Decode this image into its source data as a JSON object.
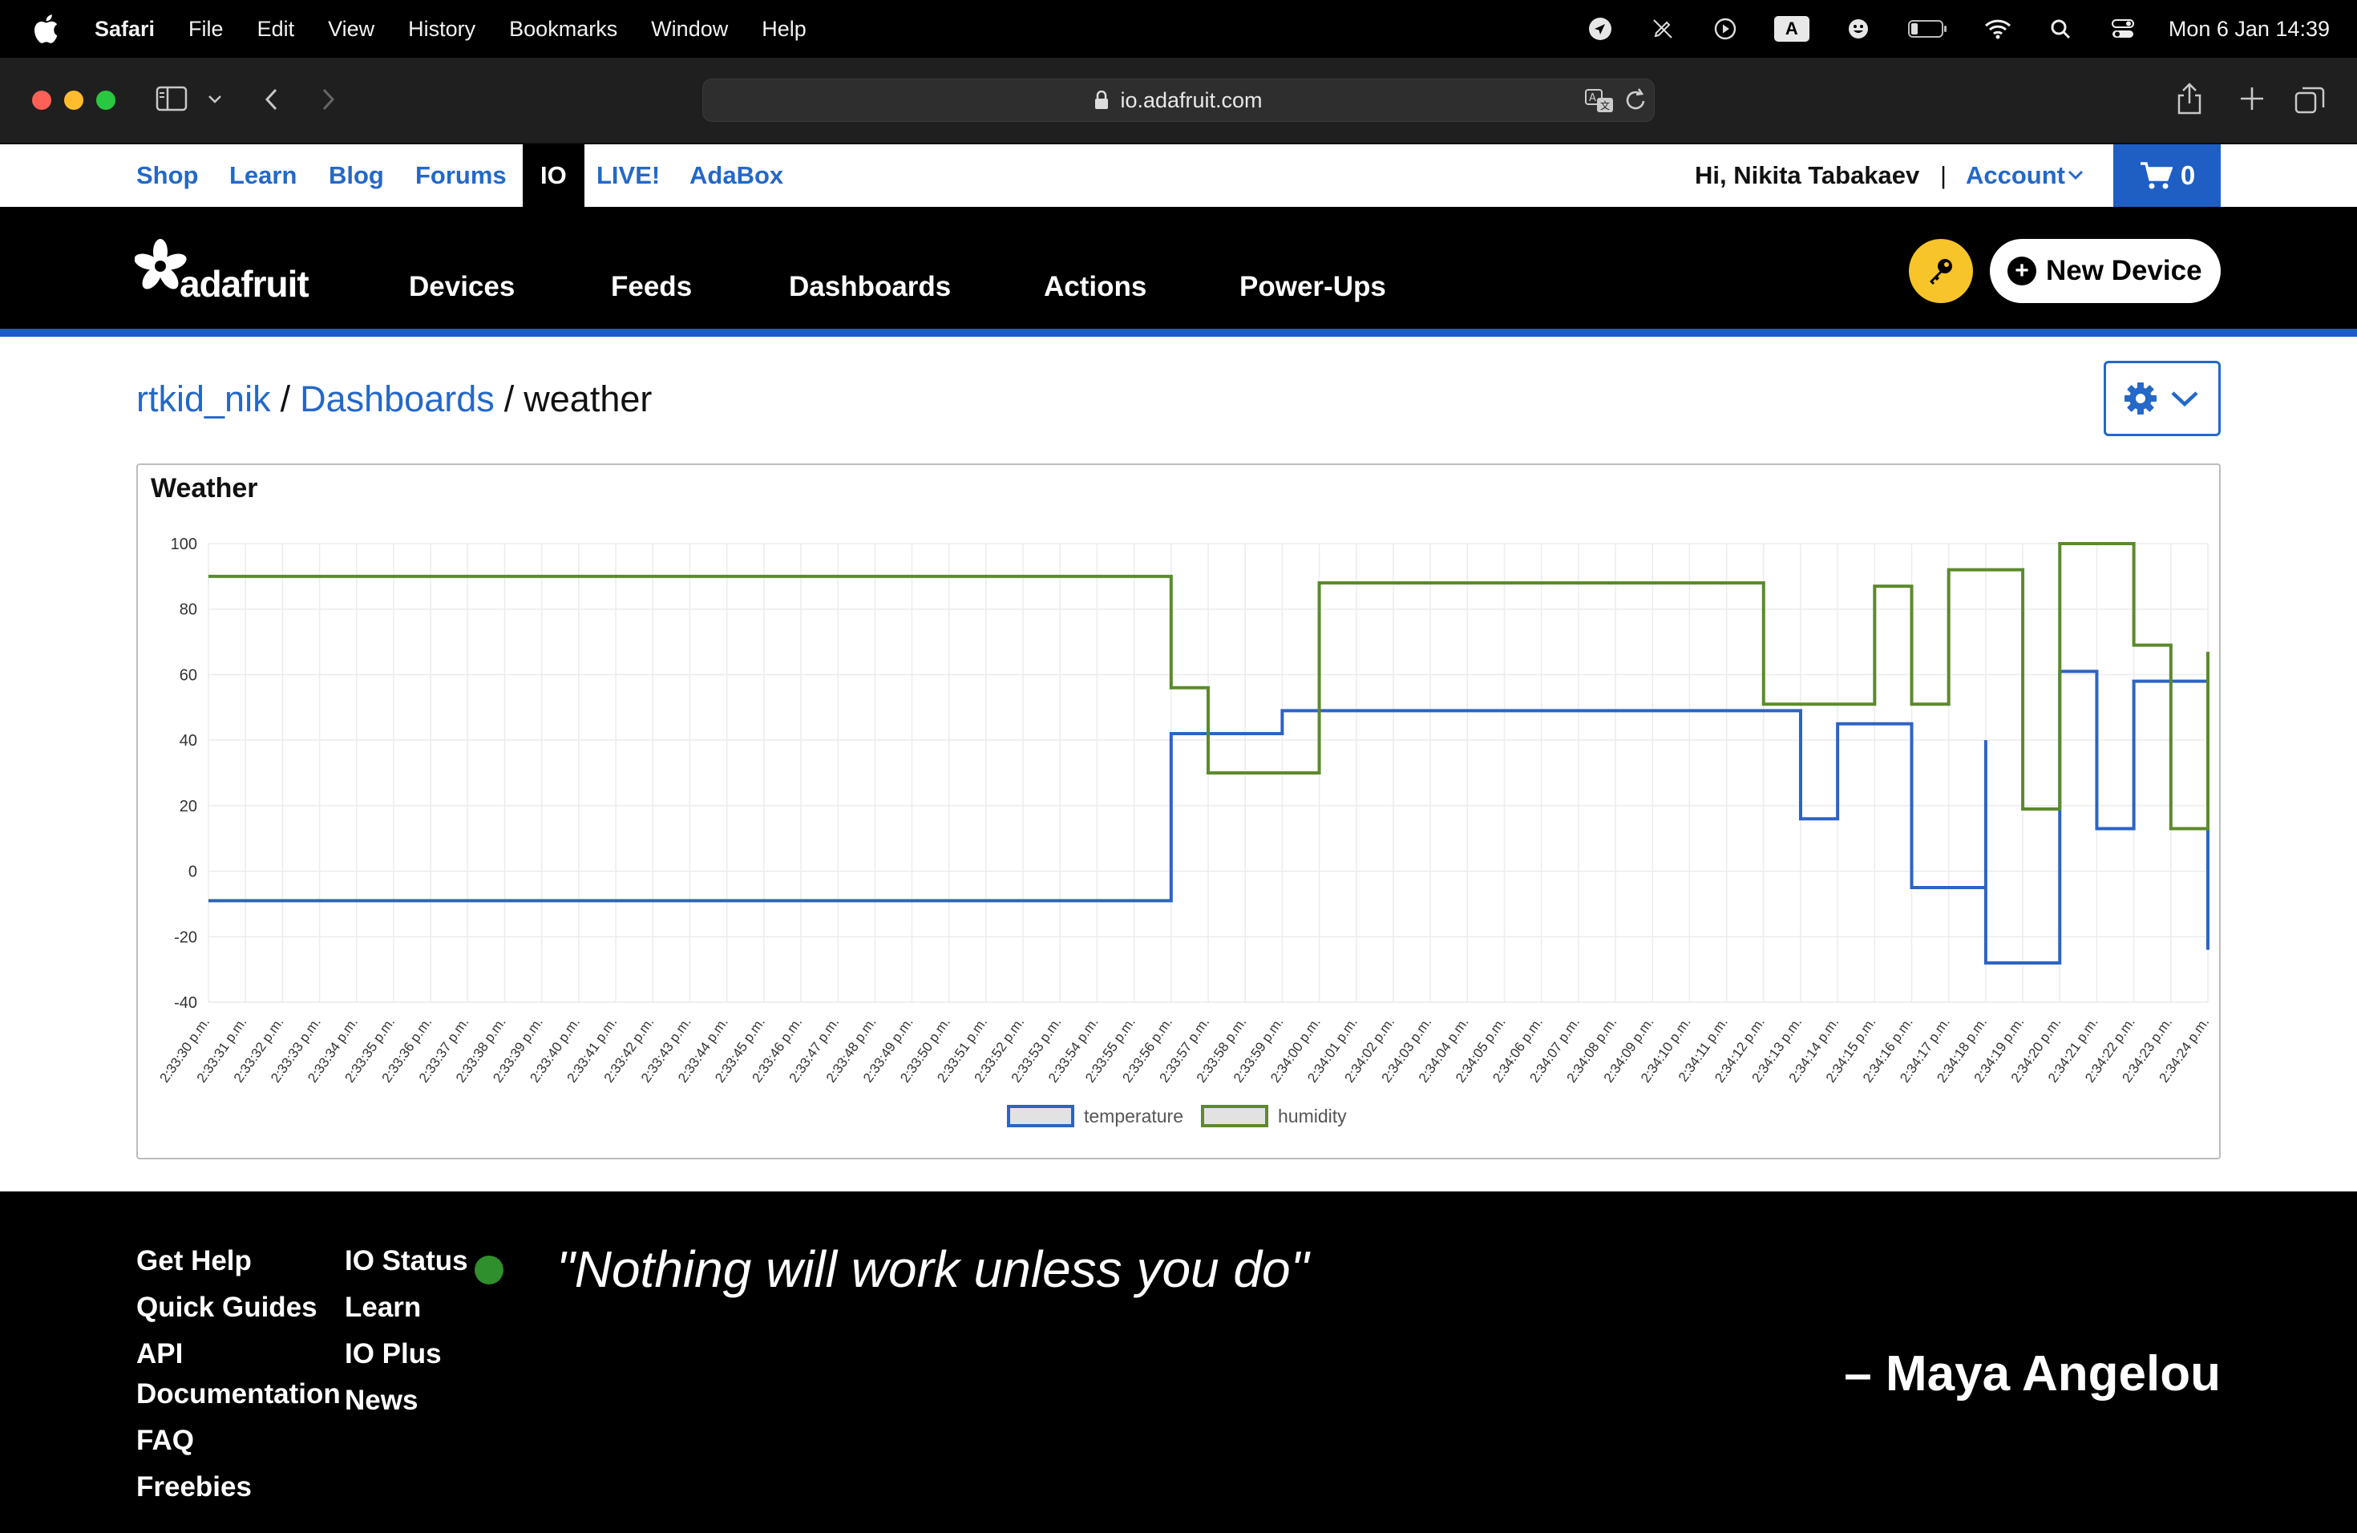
{
  "menubar": {
    "app": "Safari",
    "items": [
      "File",
      "Edit",
      "View",
      "History",
      "Bookmarks",
      "Window",
      "Help"
    ],
    "status_icons": [
      "location-arrow-icon",
      "pen-off-icon",
      "play-circle-icon",
      "input-source-a-icon",
      "smiley-icon",
      "battery-icon",
      "wifi-icon",
      "spotlight-search-icon",
      "control-center-icon"
    ],
    "input_source_letter": "A",
    "clock": "Mon 6 Jan  14:39"
  },
  "browser": {
    "url": "io.adafruit.com"
  },
  "topnav": {
    "links": [
      "Shop",
      "Learn",
      "Blog",
      "Forums",
      "IO",
      "LIVE!",
      "AdaBox"
    ],
    "active": "IO",
    "greeting": "Hi, Nikita Tabakaev",
    "separator": "|",
    "account": "Account",
    "cart_count": "0"
  },
  "io_header": {
    "brand": "adafruit",
    "nav": [
      "Devices",
      "Feeds",
      "Dashboards",
      "Actions",
      "Power-Ups"
    ],
    "new_device": "New Device",
    "colors": {
      "key_button": "#f7c42a",
      "accent_bar": "#1d5dc3"
    }
  },
  "breadcrumb": {
    "user": "rtkid_nik",
    "section": "Dashboards",
    "current": "weather"
  },
  "block": {
    "title": "Weather"
  },
  "chart_data": {
    "type": "line",
    "step": true,
    "ylim": [
      -40,
      100
    ],
    "yticks": [
      100,
      80,
      60,
      40,
      20,
      0,
      -20,
      -40
    ],
    "grid": true,
    "legend_position": "bottom",
    "categories": [
      "2:33:30 p.m.",
      "2:33:31 p.m.",
      "2:33:32 p.m.",
      "2:33:33 p.m.",
      "2:33:34 p.m.",
      "2:33:35 p.m.",
      "2:33:36 p.m.",
      "2:33:37 p.m.",
      "2:33:38 p.m.",
      "2:33:39 p.m.",
      "2:33:40 p.m.",
      "2:33:41 p.m.",
      "2:33:42 p.m.",
      "2:33:43 p.m.",
      "2:33:44 p.m.",
      "2:33:45 p.m.",
      "2:33:46 p.m.",
      "2:33:47 p.m.",
      "2:33:48 p.m.",
      "2:33:49 p.m.",
      "2:33:50 p.m.",
      "2:33:51 p.m.",
      "2:33:52 p.m.",
      "2:33:53 p.m.",
      "2:33:54 p.m.",
      "2:33:55 p.m.",
      "2:33:56 p.m.",
      "2:33:57 p.m.",
      "2:33:58 p.m.",
      "2:33:59 p.m.",
      "2:34:00 p.m.",
      "2:34:01 p.m.",
      "2:34:02 p.m.",
      "2:34:03 p.m.",
      "2:34:04 p.m.",
      "2:34:05 p.m.",
      "2:34:06 p.m.",
      "2:34:07 p.m.",
      "2:34:08 p.m.",
      "2:34:09 p.m.",
      "2:34:10 p.m.",
      "2:34:11 p.m.",
      "2:34:12 p.m.",
      "2:34:13 p.m.",
      "2:34:14 p.m.",
      "2:34:15 p.m.",
      "2:34:16 p.m.",
      "2:34:17 p.m.",
      "2:34:18 p.m.",
      "2:34:19 p.m.",
      "2:34:20 p.m.",
      "2:34:21 p.m.",
      "2:34:22 p.m.",
      "2:34:23 p.m.",
      "2:34:24 p.m."
    ],
    "series": [
      {
        "name": "temperature",
        "color": "#2d63c4",
        "points": [
          [
            "2:33:30 p.m.",
            -9
          ],
          [
            "2:33:56 p.m.",
            42
          ],
          [
            "2:33:59 p.m.",
            49
          ],
          [
            "2:34:13 p.m.",
            16
          ],
          [
            "2:34:14 p.m.",
            45
          ],
          [
            "2:34:16 p.m.",
            -5
          ],
          [
            "2:34:18 p.m.",
            40
          ],
          [
            "2:34:18 p.m.",
            -28
          ],
          [
            "2:34:20 p.m.",
            61
          ],
          [
            "2:34:21 p.m.",
            13
          ],
          [
            "2:34:22 p.m.",
            58
          ],
          [
            "2:34:24 p.m.",
            -24
          ]
        ]
      },
      {
        "name": "humidity",
        "color": "#5c8a2c",
        "points": [
          [
            "2:33:30 p.m.",
            90
          ],
          [
            "2:33:56 p.m.",
            56
          ],
          [
            "2:33:57 p.m.",
            30
          ],
          [
            "2:34:00 p.m.",
            88
          ],
          [
            "2:34:12 p.m.",
            51
          ],
          [
            "2:34:15 p.m.",
            87
          ],
          [
            "2:34:16 p.m.",
            51
          ],
          [
            "2:34:17 p.m.",
            92
          ],
          [
            "2:34:19 p.m.",
            19
          ],
          [
            "2:34:20 p.m.",
            100
          ],
          [
            "2:34:22 p.m.",
            69
          ],
          [
            "2:34:23 p.m.",
            13
          ],
          [
            "2:34:24 p.m.",
            67
          ]
        ]
      }
    ]
  },
  "footer": {
    "col1": [
      "Get Help",
      "Quick Guides",
      "API Documentation",
      "FAQ",
      "Freebies"
    ],
    "col2": [
      "IO Status",
      "Learn",
      "IO Plus",
      "News"
    ],
    "status_color": "#2f8f2c",
    "quote": "\"Nothing will work unless you do\"",
    "author": "– Maya Angelou"
  }
}
